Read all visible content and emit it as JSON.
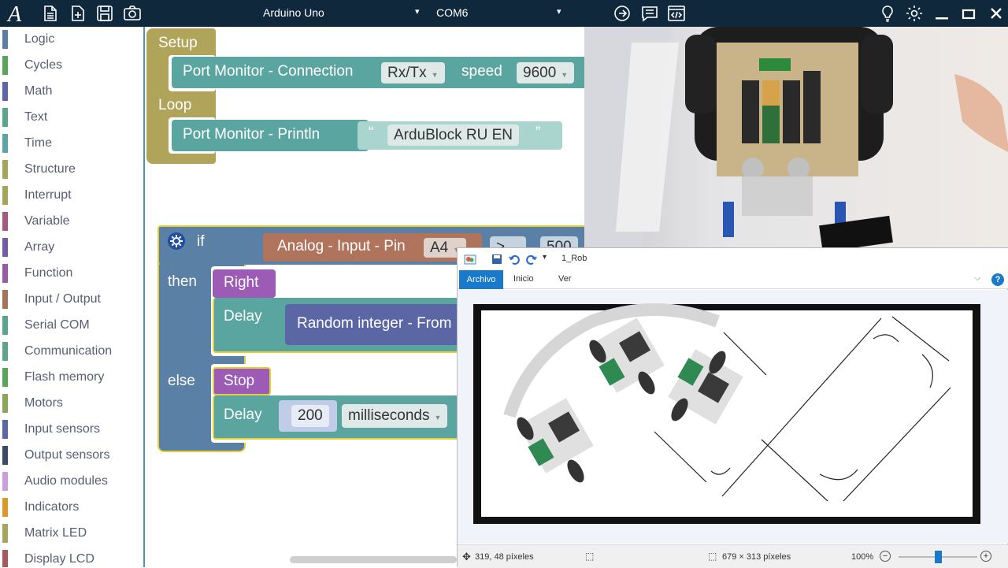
{
  "toolbar": {
    "board": "Arduino Uno",
    "port": "COM6",
    "dropdown_arrow": "▾",
    "icons": [
      "logo-icon",
      "new-file-icon",
      "open-file-icon",
      "save-icon",
      "screenshot-icon",
      "upload-icon",
      "serial-monitor-icon",
      "code-view-icon",
      "tips-icon",
      "settings-icon",
      "minimize-icon",
      "maximize-icon",
      "close-icon"
    ]
  },
  "sidebar": {
    "categories": [
      {
        "label": "Logic",
        "color": "#5b80a5"
      },
      {
        "label": "Cycles",
        "color": "#5ba55b"
      },
      {
        "label": "Math",
        "color": "#5b67a5"
      },
      {
        "label": "Text",
        "color": "#5ba58c"
      },
      {
        "label": "Time",
        "color": "#5ba5a5"
      },
      {
        "label": "Structure",
        "color": "#a5a55b"
      },
      {
        "label": "Interrupt",
        "color": "#a5a55b"
      },
      {
        "label": "Variable",
        "color": "#a55b80"
      },
      {
        "label": "Array",
        "color": "#745ba5"
      },
      {
        "label": "Function",
        "color": "#9a5ba5"
      },
      {
        "label": "Input / Output",
        "color": "#a5745b"
      },
      {
        "label": "Serial COM",
        "color": "#5ba58c"
      },
      {
        "label": "Communication",
        "color": "#5ba58c"
      },
      {
        "label": "Flash memory",
        "color": "#5ba55b"
      },
      {
        "label": "Motors",
        "color": "#8ca55b"
      },
      {
        "label": "Input sensors",
        "color": "#5b67a5"
      },
      {
        "label": "Output sensors",
        "color": "#3c4a6a"
      },
      {
        "label": "Audio modules",
        "color": "#c9a0dc"
      },
      {
        "label": "Indicators",
        "color": "#d99a2a"
      },
      {
        "label": "Matrix LED",
        "color": "#a5a55b"
      },
      {
        "label": "Display LCD",
        "color": "#a55b5b"
      }
    ]
  },
  "workspace": {
    "setup_label": "Setup",
    "loop_label": "Loop",
    "port_connection": "Port Monitor - Connection",
    "rx_tx": "Rx/Tx",
    "speed_label": "speed",
    "speed_value": "9600",
    "println": "Port Monitor - Println",
    "quote_open": "“",
    "quote_close": "”",
    "println_text": "ArduBlock RU EN",
    "if_label": "if",
    "analog_input": "Analog - Input - Pin",
    "pin": "A4",
    "compare_op": ">",
    "compare_value": "500",
    "then_label": "then",
    "right_label": "Right",
    "delay_label": "Delay",
    "random_integer": "Random integer - From",
    "else_label": "else",
    "stop_label": "Stop",
    "delay_value": "200",
    "milliseconds": "milliseconds"
  },
  "paint": {
    "title": "1_Rob",
    "tabs": {
      "archivo": "Archivo",
      "inicio": "Inicio",
      "ver": "Ver"
    },
    "help": "?",
    "status": {
      "cursor": "319, 48 píxeles",
      "size": "679 × 313 píxeles",
      "zoom": "100%",
      "zoom_level": 0.5
    }
  },
  "colors": {
    "toolbar_bg": "#10283c",
    "setup_block": "#b0a45a",
    "serial_block": "#5ba5a0",
    "logic_block": "#5b80a5",
    "input_block": "#b0735b",
    "motor_block": "#9c5bb5",
    "math_block": "#5b67a5",
    "paint_accent": "#1979ca"
  }
}
